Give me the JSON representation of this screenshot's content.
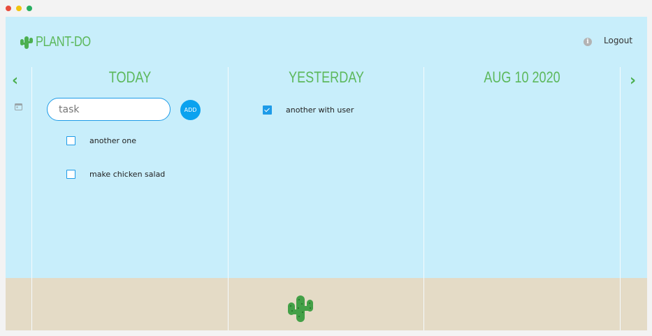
{
  "app": {
    "title": "PLANT-DO",
    "logout_label": "Logout",
    "info_icon": "info-icon",
    "logo_icon": "cactus-icon"
  },
  "nav": {
    "prev_label": "‹",
    "next_label": "›",
    "calendar_icon": "calendar-icon"
  },
  "columns": [
    {
      "title": "TODAY",
      "input": {
        "placeholder": "task",
        "value": ""
      },
      "add_label": "ADD",
      "tasks": [
        {
          "label": "another one",
          "checked": false
        },
        {
          "label": "make chicken salad",
          "checked": false
        }
      ]
    },
    {
      "title": "YESTERDAY",
      "tasks": [
        {
          "label": "another with user",
          "checked": true
        }
      ]
    },
    {
      "title": "AUG 10 2020",
      "tasks": []
    }
  ],
  "colors": {
    "sky": "#c8eefb",
    "ground": "#e4dbc6",
    "accent_green": "#5cb85c",
    "accent_blue": "#1e9be8"
  }
}
